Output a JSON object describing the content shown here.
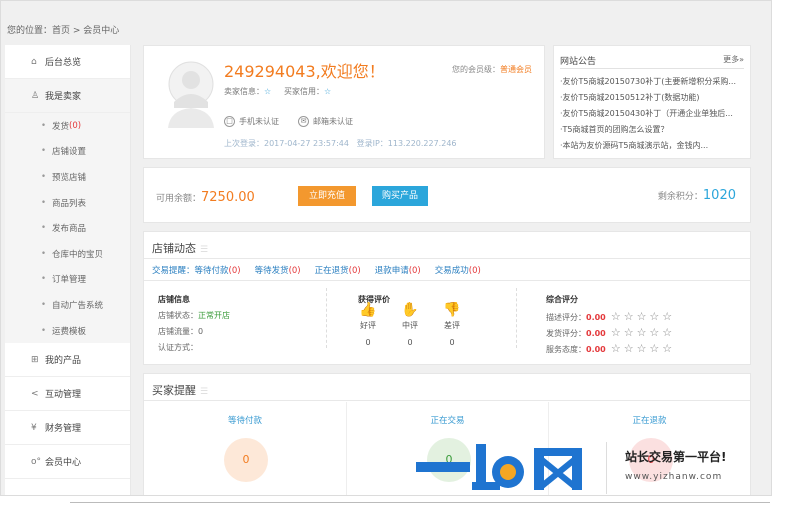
{
  "breadcrumb": {
    "text": "您的位置：首页 > 会员中心"
  },
  "sidebar": {
    "main_items": [
      {
        "label": "后台总览",
        "icon": "home-icon",
        "glyph": "⌂"
      },
      {
        "label": "我是卖家",
        "icon": "user-icon",
        "glyph": "♙"
      }
    ],
    "sub_items": [
      {
        "label": "发货",
        "count": "(0)"
      },
      {
        "label": "店铺设置"
      },
      {
        "label": "预览店铺"
      },
      {
        "label": "商品列表"
      },
      {
        "label": "发布商品"
      },
      {
        "label": "仓库中的宝贝"
      },
      {
        "label": "订单管理"
      },
      {
        "label": "自动广告系统"
      },
      {
        "label": "运费模板"
      }
    ],
    "bottom_items": [
      {
        "label": "我的产品",
        "icon": "grid-icon",
        "glyph": "⊞"
      },
      {
        "label": "互动管理",
        "icon": "share-icon",
        "glyph": "<"
      },
      {
        "label": "财务管理",
        "icon": "yen-icon",
        "glyph": "¥"
      },
      {
        "label": "会员中心",
        "icon": "member-icon",
        "glyph": "o°"
      }
    ]
  },
  "profile": {
    "welcome": "249294043,欢迎您！",
    "level_label": "您的会员级：",
    "level_value": "普通会员",
    "seller_credit_label": "卖家信息：",
    "buyer_credit_label": "买家信用：",
    "phone_cert": "手机未认证",
    "email_cert": "邮箱未认证",
    "last_login": "上次登录：2017-04-27 23:57:44",
    "login_ip": "登录IP：113.220.227.246"
  },
  "notice": {
    "title": "网站公告",
    "more": "更多»",
    "items": [
      "·友价T5商城20150730补丁(主要新增积分采购...",
      "·友价T5商城20150512补丁(数据功能)",
      "·友价T5商城20150430补丁（开通企业单独后...",
      "·T5商城首页的团购怎么设置？",
      "·本站为友价源码T5商城演示站，金钱内..."
    ]
  },
  "balance": {
    "label": "可用余额：",
    "value": "7250.00",
    "recharge_button": "立即充值",
    "buy_button": "购买产品",
    "points_label": "剩余积分：",
    "points_value": "1020"
  },
  "shop": {
    "title": "店铺动态",
    "tabs": [
      {
        "label": "交易提醒：等待付款",
        "count": "(0)"
      },
      {
        "label": "等待发货",
        "count": "(0)"
      },
      {
        "label": "正在退货",
        "count": "(0)"
      },
      {
        "label": "退款申请",
        "count": "(0)"
      },
      {
        "label": "交易成功",
        "count": "(0)"
      }
    ],
    "info_title": "店铺信息",
    "status_label": "店铺状态：",
    "status_value": "正常开店",
    "traffic": "店铺流量：0",
    "auth": "认证方式：",
    "rating_title": "获得评价",
    "ratings": [
      {
        "label": "好评",
        "value": "0",
        "icon": "thumbs-up-icon",
        "glyph": "👍"
      },
      {
        "label": "中评",
        "value": "0",
        "icon": "neutral-hand-icon",
        "glyph": "✋"
      },
      {
        "label": "差评",
        "value": "0",
        "icon": "thumbs-down-icon",
        "glyph": "👎"
      }
    ],
    "score_title": "综合评分",
    "scores": [
      {
        "label": "描述评分：",
        "value": "0.00"
      },
      {
        "label": "发货评分：",
        "value": "0.00"
      },
      {
        "label": "服务态度：",
        "value": "0.00"
      }
    ],
    "star_glyphs": "☆☆☆☆☆"
  },
  "buyer": {
    "title": "买家提醒",
    "columns": [
      {
        "label": "等待付款",
        "value": "0",
        "color": "#f27c20",
        "bg": "#fde8d8"
      },
      {
        "label": "正在交易",
        "value": "0",
        "color": "#3a9b3a",
        "bg": "#e3f1e0"
      },
      {
        "label": "正在退款",
        "value": "0",
        "color": "#e4393c",
        "bg": "#fbe0e0"
      }
    ]
  },
  "watermark": {
    "brand": "一站网",
    "slogan": "站长交易第一平台!",
    "url": "www.yizhanw.com"
  }
}
